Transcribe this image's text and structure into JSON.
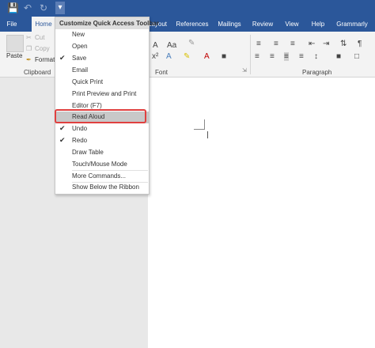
{
  "ribbon": {
    "tabs": [
      {
        "label": "File"
      },
      {
        "label": "Home"
      },
      {
        "label": "Layout"
      },
      {
        "label": "References"
      },
      {
        "label": "Mailings"
      },
      {
        "label": "Review"
      },
      {
        "label": "View"
      },
      {
        "label": "Help"
      },
      {
        "label": "Grammarly"
      }
    ],
    "clipboard": {
      "paste": "Paste",
      "cut": "Cut",
      "copy": "Copy",
      "format": "Format",
      "group_label": "Clipboard"
    },
    "font_group_label": "Font",
    "paragraph_group_label": "Paragraph"
  },
  "menu": {
    "title": "Customize Quick Access Toolbar",
    "items": [
      {
        "label": "New",
        "checked": false
      },
      {
        "label": "Open",
        "checked": false
      },
      {
        "label": "Save",
        "checked": true
      },
      {
        "label": "Email",
        "checked": false
      },
      {
        "label": "Quick Print",
        "checked": false
      },
      {
        "label": "Print Preview and Print",
        "checked": false
      },
      {
        "label": "Editor (F7)",
        "checked": false
      },
      {
        "label": "Read Aloud",
        "checked": false
      },
      {
        "label": "Undo",
        "checked": true
      },
      {
        "label": "Redo",
        "checked": true
      },
      {
        "label": "Draw Table",
        "checked": false
      },
      {
        "label": "Touch/Mouse Mode",
        "checked": false
      },
      {
        "label": "More Commands...",
        "checked": false
      },
      {
        "label": "Show Below the Ribbon",
        "checked": false
      }
    ]
  },
  "icons": {
    "save": "save-icon",
    "undo": "undo-icon",
    "redo": "redo-icon",
    "customize": "customize-qat-icon"
  },
  "colors": {
    "ribbon_blue": "#2b579a",
    "highlight_red": "#e0403f"
  }
}
